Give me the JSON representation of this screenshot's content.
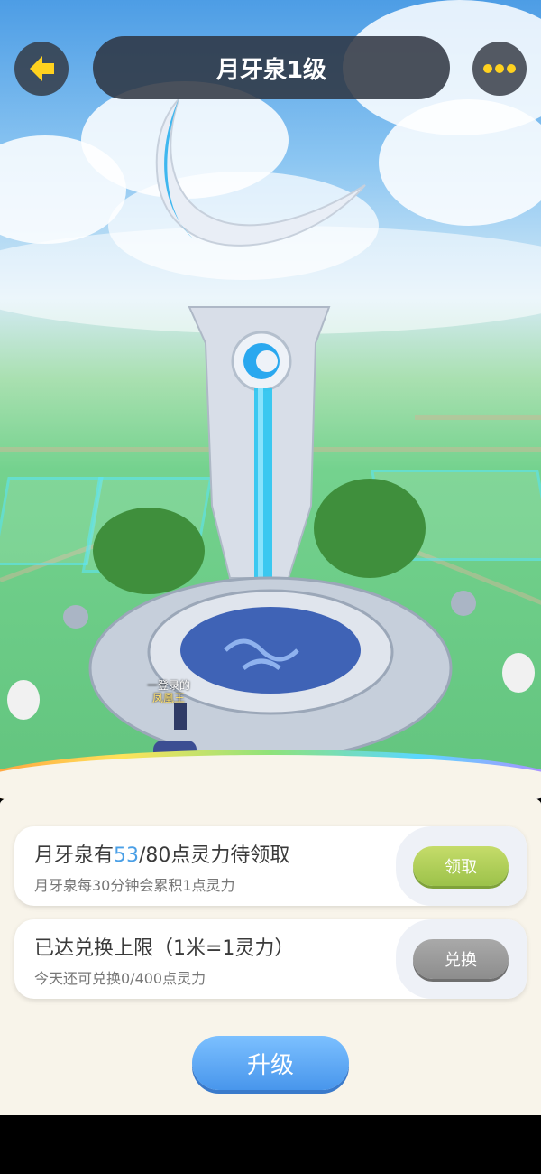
{
  "header": {
    "title": "月牙泉1级",
    "back_icon": "arrow-left-icon",
    "more_icon": "more-dots-icon"
  },
  "scene": {
    "npc_label_line1": "一登录的",
    "npc_label_line2": "凤凰王"
  },
  "cards": [
    {
      "main_prefix": "月牙泉有",
      "main_value": "53",
      "main_suffix": "/80点灵力待领取",
      "sub": "月牙泉每30分钟会累积1点灵力",
      "button": "领取"
    },
    {
      "main": "已达兑换上限（1米=1灵力）",
      "sub": "今天还可兑换0/400点灵力",
      "button": "兑换"
    }
  ],
  "upgrade_button": "升级",
  "colors": {
    "highlight": "#4a9fe6",
    "claim_button": "#9cc24a",
    "exchange_button": "#8d8d8d",
    "upgrade_button": "#4896ec"
  }
}
